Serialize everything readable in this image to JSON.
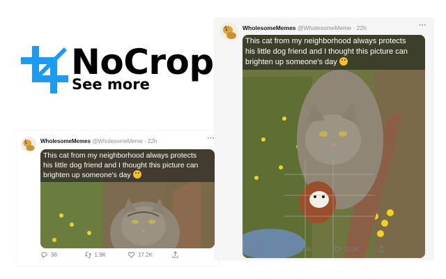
{
  "logo": {
    "title": "NoCrop",
    "subtitle": "See more",
    "icon": "crop-icon",
    "accent_color": "#1d9bf0"
  },
  "tweet": {
    "display_name": "WholesomeMemes",
    "handle": "@WholesomeMeme",
    "separator": "·",
    "time": "22h",
    "more_icon": "more-icon",
    "caption_lines": [
      "This cat from my neighborhood always protects",
      "his little dog friend and I thought this picture can",
      "brighten up someone's day"
    ],
    "actions": {
      "reply": "36",
      "retweet": "1.9K",
      "like": "17.2K"
    }
  }
}
